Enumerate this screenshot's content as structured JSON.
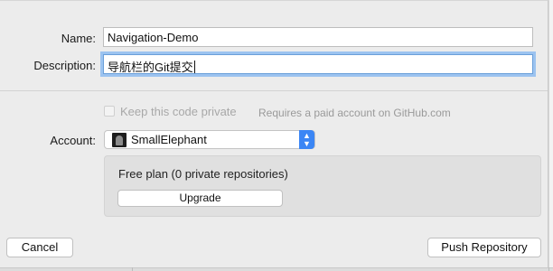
{
  "form": {
    "name_label": "Name:",
    "name_value": "Navigation-Demo",
    "description_label": "Description:",
    "description_value": "导航栏的Git提交"
  },
  "privacy": {
    "checkbox_label": "Keep this code private",
    "note": "Requires a paid account on GitHub.com",
    "checked": false
  },
  "account": {
    "label": "Account:",
    "selected": "SmallElephant"
  },
  "plan": {
    "text": "Free plan (0 private repositories)",
    "upgrade_label": "Upgrade"
  },
  "footer": {
    "cancel_label": "Cancel",
    "push_label": "Push Repository"
  },
  "colors": {
    "focus_ring": "#9cc3f0",
    "stepper": "#3b86f5"
  }
}
